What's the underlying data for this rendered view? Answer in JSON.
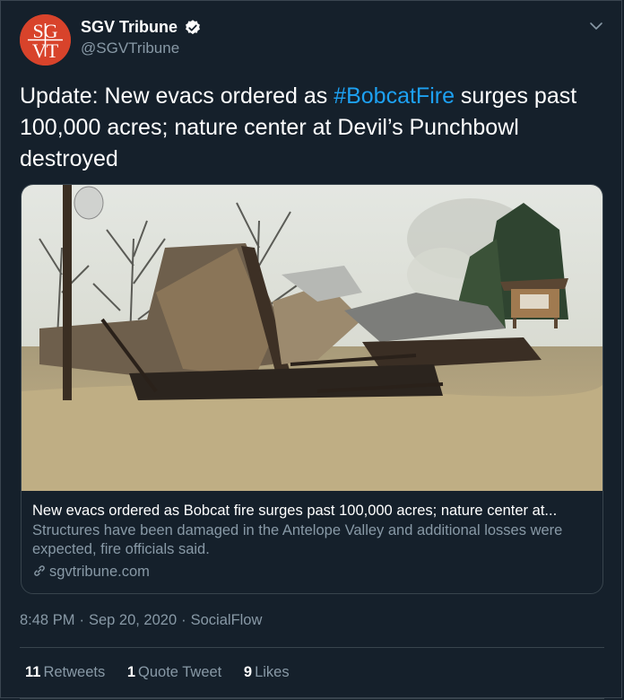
{
  "author": {
    "display_name": "SGV Tribune",
    "handle": "@SGVTribune",
    "avatar_text_top": "SG",
    "avatar_text_bottom": "VT",
    "avatar_color": "#d8432b",
    "verified_icon": "verified-badge-icon"
  },
  "menu_icon": "chevron-down-icon",
  "tweet": {
    "text_prefix": "Update: New evacs ordered as ",
    "hashtag": "#BobcatFire",
    "text_suffix": " surges past 100,000 acres; nature center at Devil’s Punchbowl destroyed"
  },
  "card": {
    "image_alt": "burned structure",
    "title": "New evacs ordered as Bobcat fire surges past 100,000 acres; nature center at...",
    "description": "Structures have been damaged in the Antelope Valley and additional losses were expected, fire officials said.",
    "domain": "sgvtribune.com",
    "domain_icon": "link-icon"
  },
  "meta": {
    "time": "8:48 PM",
    "date": "Sep 20, 2020",
    "source": "SocialFlow",
    "separator": "·"
  },
  "stats": {
    "retweets_count": "11",
    "retweets_label": "Retweets",
    "quotes_count": "1",
    "quotes_label": "Quote Tweet",
    "likes_count": "9",
    "likes_label": "Likes"
  },
  "colors": {
    "background": "#15202b",
    "accent": "#1da1f2",
    "secondary_text": "#8899a6",
    "border": "#38444d"
  }
}
